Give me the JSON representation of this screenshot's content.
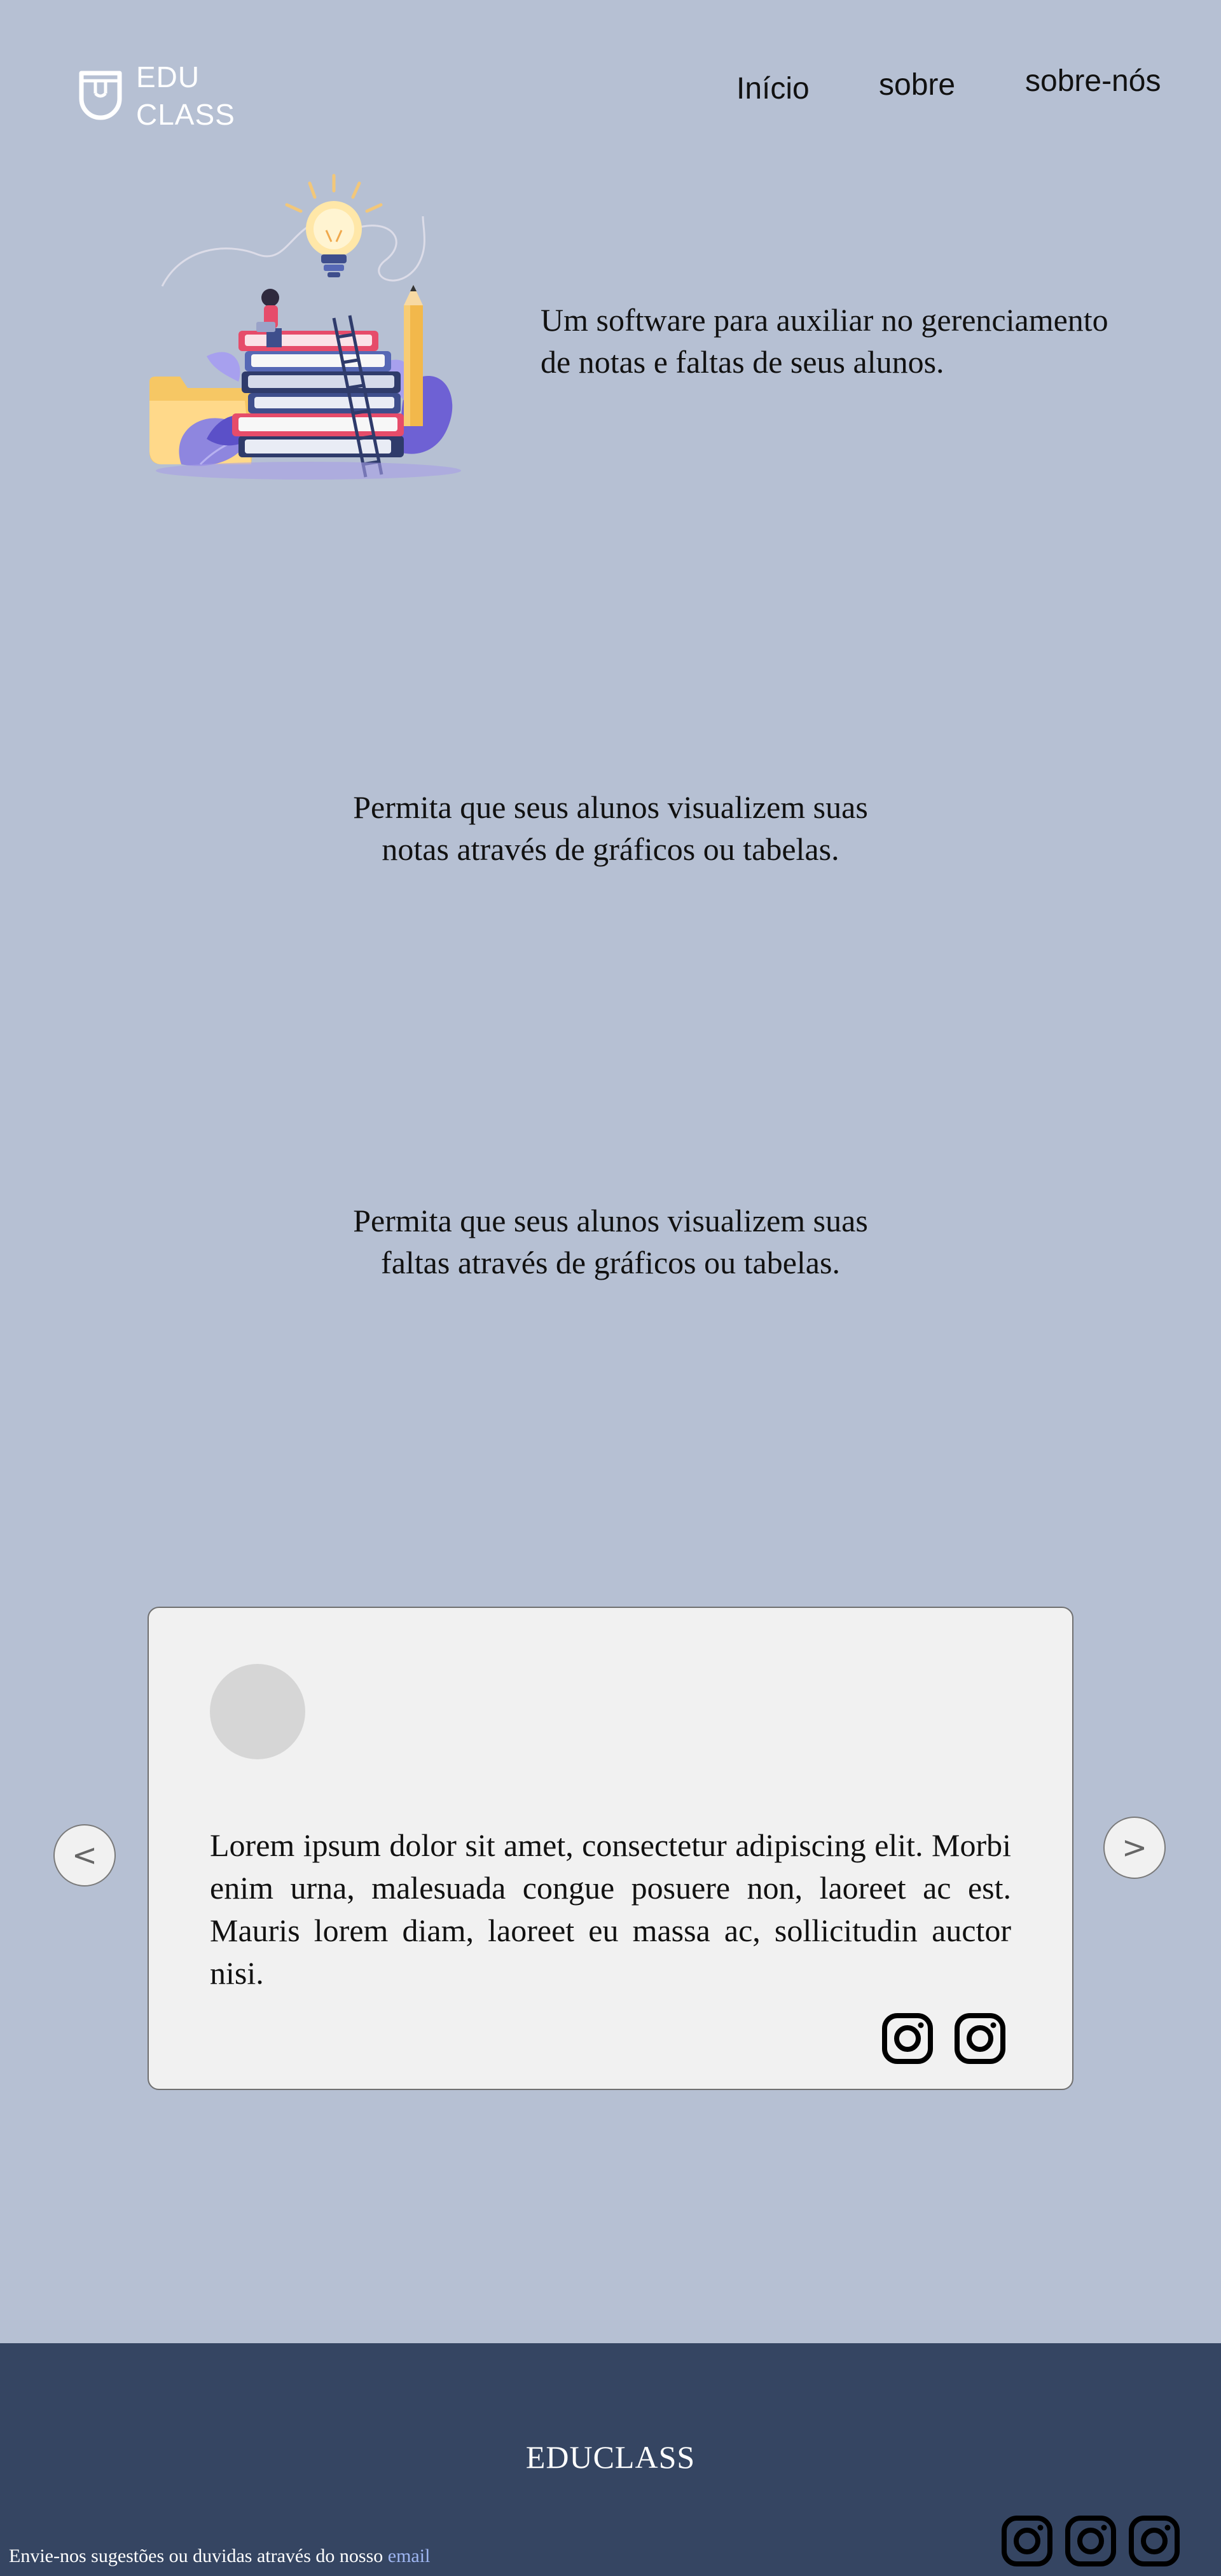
{
  "header": {
    "logo_line1": "EDU",
    "logo_line2": "CLASS",
    "nav": {
      "inicio": "Início",
      "sobre": "sobre",
      "sobre_nos": "sobre-nós"
    }
  },
  "hero": {
    "text_line1": "Um software para auxiliar no gerenciamento",
    "text_line2": "de notas e faltas de seus alunos.",
    "illustration_icon": "education-books-lightbulb-illustration"
  },
  "features": {
    "grades_line1": "Permita que seus alunos visualizem suas",
    "grades_line2": "notas através de gráficos ou tabelas.",
    "absences_line1": "Permita que seus alunos visualizem suas",
    "absences_line2": "faltas através de gráficos ou tabelas."
  },
  "testimonial": {
    "text": "Lorem ipsum dolor sit amet, consectetur adipiscing elit. Morbi enim urna, malesuada congue posuere non, laoreet ac est. Mauris lorem diam, laoreet eu massa ac, sollicitudin auctor nisi.",
    "prev_icon": "<",
    "next_icon": ">",
    "social_icons": [
      "instagram-icon",
      "instagram-icon"
    ]
  },
  "footer": {
    "brand": "EDUCLASS",
    "note_prefix": "Envie-nos sugestões ou duvidas através do nosso ",
    "note_link": "email",
    "social_icons": [
      "instagram-icon",
      "instagram-icon",
      "instagram-icon"
    ]
  },
  "colors": {
    "page_background": "#b6c0d3",
    "card_background": "#f1f1f1",
    "footer_background": "#354562",
    "link_color": "#9fb6f2"
  }
}
